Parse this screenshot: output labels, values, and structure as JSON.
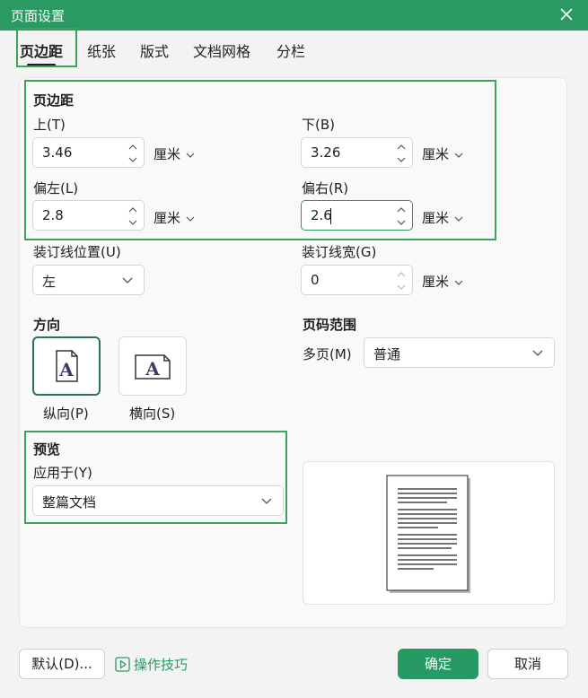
{
  "window": {
    "title": "页面设置"
  },
  "tabs": [
    {
      "label": "页边距",
      "active": true
    },
    {
      "label": "纸张"
    },
    {
      "label": "版式"
    },
    {
      "label": "文档网格"
    },
    {
      "label": "分栏"
    }
  ],
  "margins": {
    "section_title": "页边距",
    "top": {
      "label": "上(T)",
      "value": "3.46",
      "unit": "厘米"
    },
    "bottom": {
      "label": "下(B)",
      "value": "3.26",
      "unit": "厘米"
    },
    "left": {
      "label": "偏左(L)",
      "value": "2.8",
      "unit": "厘米"
    },
    "right": {
      "label": "偏右(R)",
      "value": "2.6",
      "unit": "厘米"
    },
    "gutter_pos": {
      "label": "装订线位置(U)",
      "value": "左"
    },
    "gutter_width": {
      "label": "装订线宽(G)",
      "value": "0",
      "unit": "厘米"
    }
  },
  "orientation": {
    "section_title": "方向",
    "portrait": {
      "label": "纵向(P)",
      "glyph": "A",
      "selected": true
    },
    "landscape": {
      "label": "横向(S)",
      "glyph": "A"
    }
  },
  "page_range": {
    "section_title": "页码范围",
    "label": "多页(M)",
    "value": "普通"
  },
  "preview": {
    "section_title": "预览",
    "apply_label": "应用于(Y)",
    "apply_value": "整篇文档"
  },
  "footer": {
    "default_button": "默认(D)...",
    "tips_link": "操作技巧",
    "ok_button": "确定",
    "cancel_button": "取消"
  },
  "colors": {
    "accent": "#279a63",
    "highlight": "#3aa55a"
  }
}
